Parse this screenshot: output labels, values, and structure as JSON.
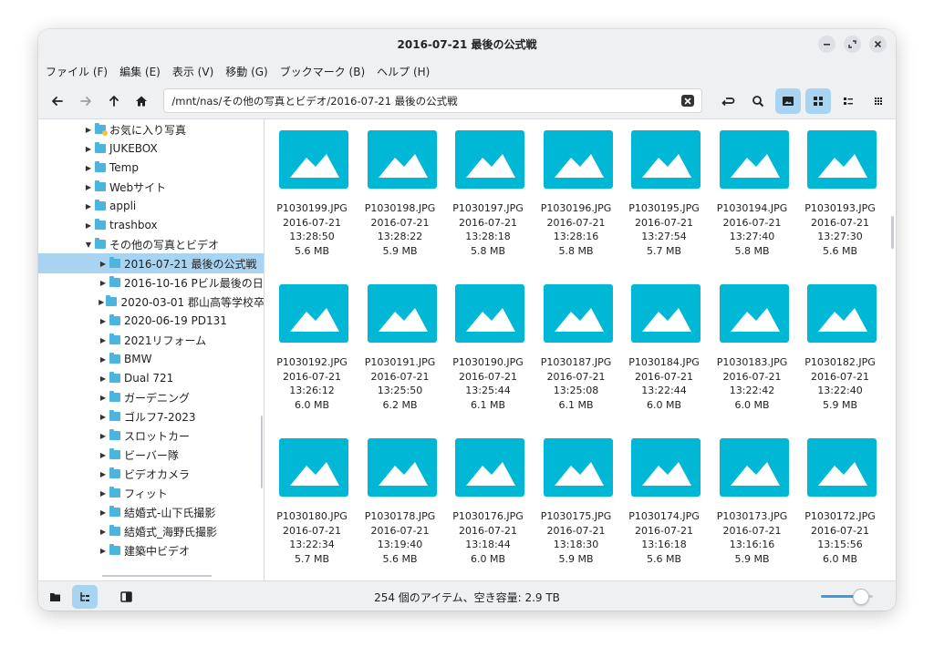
{
  "window": {
    "title": "2016-07-21 最後の公式戦"
  },
  "menu": [
    "ファイル (F)",
    "編集 (E)",
    "表示 (V)",
    "移動 (G)",
    "ブックマーク (B)",
    "ヘルプ (H)"
  ],
  "toolbar": {
    "path": "/mnt/nas/その他の写真とビデオ/2016-07-21 最後の公式戦",
    "icons": [
      "back-arrow-icon",
      "forward-arrow-icon",
      "up-arrow-icon",
      "home-icon",
      "clear-icon",
      "refresh-icon",
      "search-icon",
      "image-view-icon",
      "grid-view-icon",
      "list-view-icon",
      "compact-view-icon"
    ]
  },
  "sidebar": {
    "items": [
      {
        "label": "お気に入り写真",
        "level": 1,
        "expanded": false,
        "selected": false,
        "star": true
      },
      {
        "label": "JUKEBOX",
        "level": 1,
        "expanded": false,
        "selected": false
      },
      {
        "label": "Temp",
        "level": 1,
        "expanded": false,
        "selected": false
      },
      {
        "label": "Webサイト",
        "level": 1,
        "expanded": false,
        "selected": false
      },
      {
        "label": "appli",
        "level": 1,
        "expanded": false,
        "selected": false
      },
      {
        "label": "trashbox",
        "level": 1,
        "expanded": false,
        "selected": false
      },
      {
        "label": "その他の写真とビデオ",
        "level": 1,
        "expanded": true,
        "selected": false
      },
      {
        "label": "2016-07-21 最後の公式戦",
        "level": 2,
        "expanded": false,
        "selected": true
      },
      {
        "label": "2016-10-16 Pビル最後の日",
        "level": 2,
        "expanded": false,
        "selected": false
      },
      {
        "label": "2020-03-01 郡山高等学校卒",
        "level": 2,
        "expanded": false,
        "selected": false
      },
      {
        "label": "2020-06-19 PD131",
        "level": 2,
        "expanded": false,
        "selected": false
      },
      {
        "label": "2021リフォーム",
        "level": 2,
        "expanded": false,
        "selected": false
      },
      {
        "label": "BMW",
        "level": 2,
        "expanded": false,
        "selected": false
      },
      {
        "label": "Dual 721",
        "level": 2,
        "expanded": false,
        "selected": false
      },
      {
        "label": "ガーデニング",
        "level": 2,
        "expanded": false,
        "selected": false
      },
      {
        "label": "ゴルフ7-2023",
        "level": 2,
        "expanded": false,
        "selected": false
      },
      {
        "label": "スロットカー",
        "level": 2,
        "expanded": false,
        "selected": false
      },
      {
        "label": "ビーバー隊",
        "level": 2,
        "expanded": false,
        "selected": false
      },
      {
        "label": "ビデオカメラ",
        "level": 2,
        "expanded": false,
        "selected": false
      },
      {
        "label": "フィット",
        "level": 2,
        "expanded": false,
        "selected": false
      },
      {
        "label": "結婚式-山下氏撮影",
        "level": 2,
        "expanded": false,
        "selected": false
      },
      {
        "label": "結婚式_海野氏撮影",
        "level": 2,
        "expanded": false,
        "selected": false
      },
      {
        "label": "建築中ビデオ",
        "level": 2,
        "expanded": false,
        "selected": false
      }
    ]
  },
  "files": [
    {
      "name": "P1030199.JPG",
      "date": "2016-07-21",
      "time": "13:28:50",
      "size": "5.6 MB"
    },
    {
      "name": "P1030198.JPG",
      "date": "2016-07-21",
      "time": "13:28:22",
      "size": "5.9 MB"
    },
    {
      "name": "P1030197.JPG",
      "date": "2016-07-21",
      "time": "13:28:18",
      "size": "5.8 MB"
    },
    {
      "name": "P1030196.JPG",
      "date": "2016-07-21",
      "time": "13:28:16",
      "size": "5.8 MB"
    },
    {
      "name": "P1030195.JPG",
      "date": "2016-07-21",
      "time": "13:27:54",
      "size": "5.7 MB"
    },
    {
      "name": "P1030194.JPG",
      "date": "2016-07-21",
      "time": "13:27:40",
      "size": "5.8 MB"
    },
    {
      "name": "P1030193.JPG",
      "date": "2016-07-21",
      "time": "13:27:30",
      "size": "5.6 MB"
    },
    {
      "name": "P1030192.JPG",
      "date": "2016-07-21",
      "time": "13:26:12",
      "size": "6.0 MB"
    },
    {
      "name": "P1030191.JPG",
      "date": "2016-07-21",
      "time": "13:25:50",
      "size": "6.2 MB"
    },
    {
      "name": "P1030190.JPG",
      "date": "2016-07-21",
      "time": "13:25:44",
      "size": "6.1 MB"
    },
    {
      "name": "P1030187.JPG",
      "date": "2016-07-21",
      "time": "13:25:08",
      "size": "6.1 MB"
    },
    {
      "name": "P1030184.JPG",
      "date": "2016-07-21",
      "time": "13:22:44",
      "size": "6.0 MB"
    },
    {
      "name": "P1030183.JPG",
      "date": "2016-07-21",
      "time": "13:22:42",
      "size": "6.0 MB"
    },
    {
      "name": "P1030182.JPG",
      "date": "2016-07-21",
      "time": "13:22:40",
      "size": "5.9 MB"
    },
    {
      "name": "P1030180.JPG",
      "date": "2016-07-21",
      "time": "13:22:34",
      "size": "5.7 MB"
    },
    {
      "name": "P1030178.JPG",
      "date": "2016-07-21",
      "time": "13:19:40",
      "size": "5.6 MB"
    },
    {
      "name": "P1030176.JPG",
      "date": "2016-07-21",
      "time": "13:18:44",
      "size": "6.0 MB"
    },
    {
      "name": "P1030175.JPG",
      "date": "2016-07-21",
      "time": "13:18:30",
      "size": "5.9 MB"
    },
    {
      "name": "P1030174.JPG",
      "date": "2016-07-21",
      "time": "13:16:18",
      "size": "5.6 MB"
    },
    {
      "name": "P1030173.JPG",
      "date": "2016-07-21",
      "time": "13:16:16",
      "size": "5.9 MB"
    },
    {
      "name": "P1030172.JPG",
      "date": "2016-07-21",
      "time": "13:15:56",
      "size": "6.0 MB"
    }
  ],
  "statusbar": {
    "text": "254 個のアイテム、空き容量: 2.9 TB",
    "zoom_level": 0.8
  },
  "colors": {
    "accent": "#3d9be0",
    "selection": "#a8d4f2",
    "thumbnail": "#00b7d6",
    "folder": "#4cb4dd"
  }
}
